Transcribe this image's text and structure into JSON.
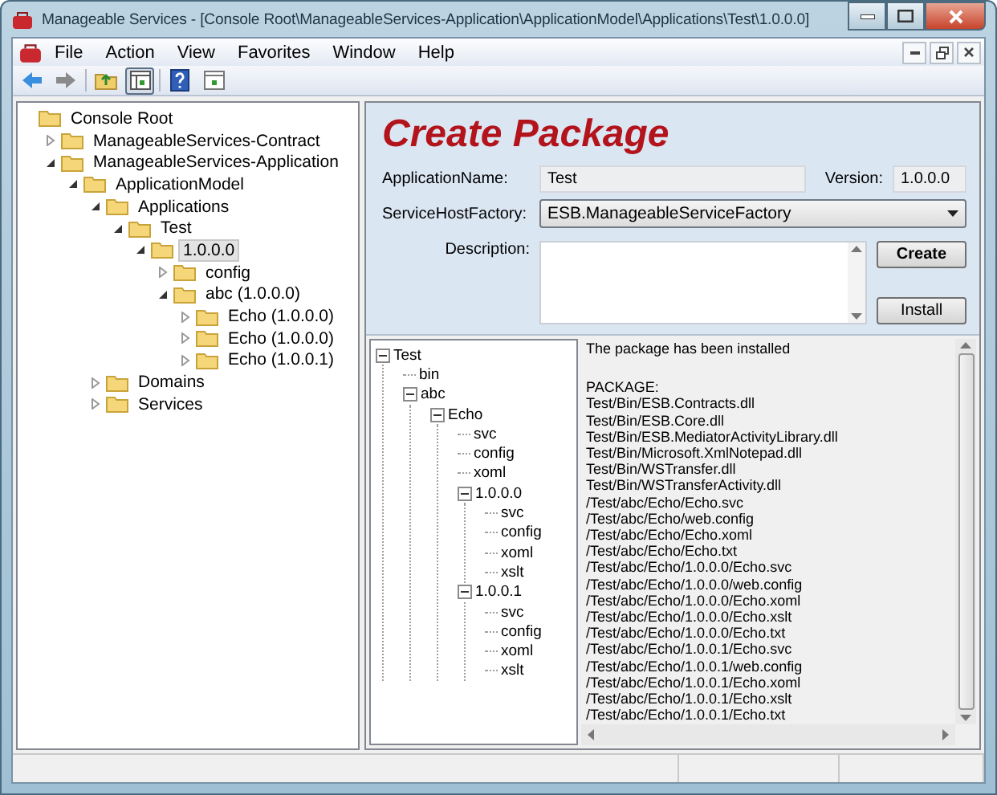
{
  "window": {
    "title": "Manageable Services - [Console Root\\ManageableServices-Application\\ApplicationModel\\Applications\\Test\\1.0.0.0]"
  },
  "menu": [
    "File",
    "Action",
    "View",
    "Favorites",
    "Window",
    "Help"
  ],
  "toolbar": [
    {
      "kind": "back",
      "pressed": false
    },
    {
      "kind": "forward",
      "pressed": false
    },
    {
      "kind": "up",
      "pressed": false
    },
    {
      "kind": "tree",
      "pressed": true
    },
    {
      "kind": "help",
      "pressed": false
    },
    {
      "kind": "pane",
      "pressed": false
    }
  ],
  "nav_tree": [
    {
      "label": "Console Root",
      "selected": false,
      "children": [
        {
          "label": "ManageableServices-Contract",
          "selected": false,
          "expanded": false
        },
        {
          "label": "ManageableServices-Application",
          "selected": false,
          "expanded": true,
          "children": [
            {
              "label": "ApplicationModel",
              "selected": false,
              "expanded": true,
              "children": [
                {
                  "label": "Applications",
                  "selected": false,
                  "expanded": true,
                  "children": [
                    {
                      "label": "Test",
                      "selected": false,
                      "expanded": true,
                      "children": [
                        {
                          "label": "1.0.0.0",
                          "selected": true,
                          "expanded": true,
                          "children": [
                            {
                              "label": "config",
                              "selected": false,
                              "expanded": false
                            },
                            {
                              "label": "abc (1.0.0.0)",
                              "selected": false,
                              "expanded": true,
                              "children": [
                                {
                                  "label": "Echo (1.0.0.0)",
                                  "selected": false,
                                  "expanded": false
                                },
                                {
                                  "label": "Echo (1.0.0.0)",
                                  "selected": false,
                                  "expanded": false
                                },
                                {
                                  "label": "Echo (1.0.0.1)",
                                  "selected": false,
                                  "expanded": false
                                }
                              ]
                            }
                          ]
                        }
                      ]
                    }
                  ]
                },
                {
                  "label": "Domains",
                  "selected": false,
                  "expanded": false
                },
                {
                  "label": "Services",
                  "selected": false,
                  "expanded": false
                }
              ]
            }
          ]
        }
      ]
    }
  ],
  "form": {
    "title": "Create Package",
    "application_name_label": "ApplicationName:",
    "application_name": "Test",
    "version_label": "Version:",
    "version": "1.0.0.0",
    "factory_label": "ServiceHostFactory:",
    "factory": "ESB.ManageableServiceFactory",
    "description_label": "Description:",
    "buttons": [
      "Create",
      "Install"
    ]
  },
  "file_tree": [
    {
      "label": "Test",
      "children": [
        {
          "label": "bin"
        },
        {
          "label": "abc",
          "children": [
            {
              "label": "Echo",
              "children": [
                {
                  "label": "svc"
                },
                {
                  "label": "config"
                },
                {
                  "label": "xoml"
                },
                {
                  "label": "1.0.0.0",
                  "children": [
                    {
                      "label": "svc"
                    },
                    {
                      "label": "config"
                    },
                    {
                      "label": "xoml"
                    },
                    {
                      "label": "xslt"
                    }
                  ]
                },
                {
                  "label": "1.0.0.1",
                  "children": [
                    {
                      "label": "svc"
                    },
                    {
                      "label": "config"
                    },
                    {
                      "label": "xoml"
                    },
                    {
                      "label": "xslt"
                    }
                  ]
                }
              ]
            }
          ]
        }
      ]
    }
  ],
  "log": {
    "message": "The package has been installed",
    "header": "PACKAGE:",
    "files": [
      "Test/Bin/ESB.Contracts.dll",
      "Test/Bin/ESB.Core.dll",
      "Test/Bin/ESB.MediatorActivityLibrary.dll",
      "Test/Bin/Microsoft.XmlNotepad.dll",
      "Test/Bin/WSTransfer.dll",
      "Test/Bin/WSTransferActivity.dll",
      "/Test/abc/Echo/Echo.svc",
      "/Test/abc/Echo/web.config",
      "/Test/abc/Echo/Echo.xoml",
      "/Test/abc/Echo/Echo.txt",
      "/Test/abc/Echo/1.0.0.0/Echo.svc",
      "/Test/abc/Echo/1.0.0.0/web.config",
      "/Test/abc/Echo/1.0.0.0/Echo.xoml",
      "/Test/abc/Echo/1.0.0.0/Echo.xslt",
      "/Test/abc/Echo/1.0.0.0/Echo.txt",
      "/Test/abc/Echo/1.0.0.1/Echo.svc",
      "/Test/abc/Echo/1.0.0.1/web.config",
      "/Test/abc/Echo/1.0.0.1/Echo.xoml",
      "/Test/abc/Echo/1.0.0.1/Echo.xslt",
      "/Test/abc/Echo/1.0.0.1/Echo.txt"
    ]
  }
}
